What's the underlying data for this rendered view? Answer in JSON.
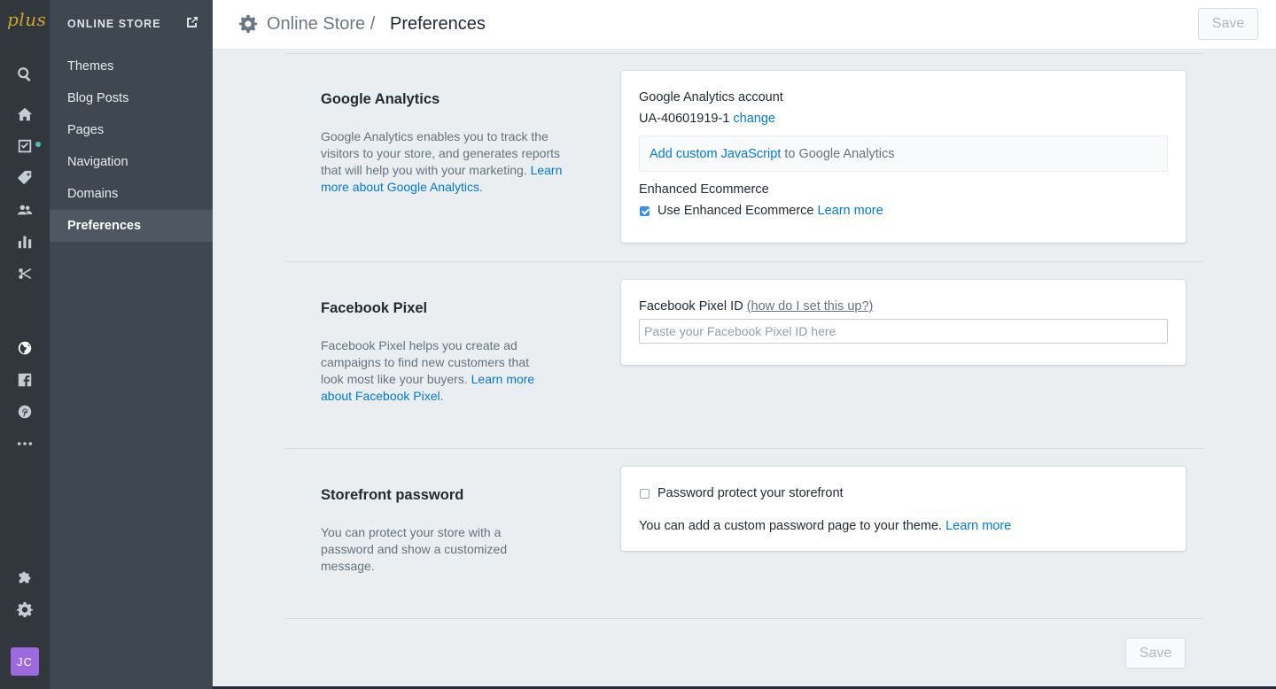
{
  "brand": {
    "logo_text": "plus"
  },
  "rail": {
    "icons": [
      "search-icon",
      "home-icon",
      "orders-icon",
      "products-icon",
      "customers-icon",
      "analytics-icon",
      "discounts-icon",
      "online-store-icon",
      "facebook-icon",
      "pinterest-icon",
      "more-icon",
      "apps-icon",
      "settings-icon"
    ],
    "notification_color": "#47c1bf",
    "avatar_initials": "JC",
    "avatar_color": "#9c6ade"
  },
  "subnav": {
    "header": "ONLINE STORE",
    "items": [
      {
        "label": "Themes"
      },
      {
        "label": "Blog Posts"
      },
      {
        "label": "Pages"
      },
      {
        "label": "Navigation"
      },
      {
        "label": "Domains"
      },
      {
        "label": "Preferences",
        "active": true
      }
    ]
  },
  "topbar": {
    "breadcrumb": "Online Store /",
    "title": "Preferences",
    "save_label": "Save"
  },
  "google_analytics": {
    "title": "Google Analytics",
    "desc": "Google Analytics enables you to track the visitors to your store, and generates reports that will help you with your marketing.",
    "desc_link": "Learn more about Google Analytics.",
    "account_label": "Google Analytics account",
    "account_id": "UA-40601919-1",
    "change_link": "change",
    "js_link": "Add custom JavaScript",
    "js_suffix": "to Google Analytics",
    "enhanced_label": "Enhanced Ecommerce",
    "enhanced_checkbox_label": "Use Enhanced Ecommerce",
    "enhanced_checked": true,
    "enhanced_learn_more": "Learn more"
  },
  "facebook_pixel": {
    "title": "Facebook Pixel",
    "desc": "Facebook Pixel helps you create ad campaigns to find new customers that look most like your buyers.",
    "desc_link": "Learn more about Facebook Pixel.",
    "field_label": "Facebook Pixel ID",
    "help_link": "(how do I set this up?)",
    "placeholder": "Paste your Facebook Pixel ID here",
    "value": ""
  },
  "storefront_password": {
    "title": "Storefront password",
    "desc": "You can protect your store with a password and show a customized message.",
    "checkbox_label": "Password protect your storefront",
    "checked": false,
    "note": "You can add a custom password page to your theme.",
    "note_link": "Learn more"
  },
  "footer": {
    "save_label": "Save"
  },
  "colors": {
    "link": "#007ace",
    "sidebar": "#3f4850",
    "rail": "#31373d",
    "active_item": "#4f5862"
  }
}
